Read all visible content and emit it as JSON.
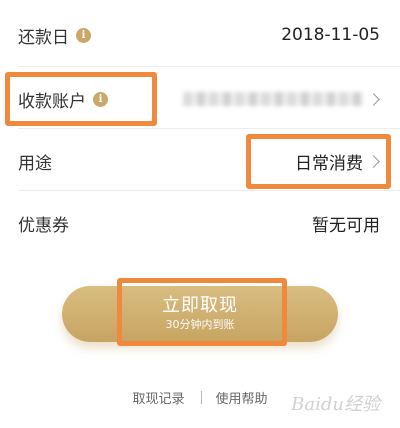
{
  "rows": {
    "due_date": {
      "label": "还款日",
      "value": "2018-11-05"
    },
    "account": {
      "label": "收款账户"
    },
    "purpose": {
      "label": "用途",
      "value": "日常消费"
    },
    "coupon": {
      "label": "优惠券",
      "value": "暂无可用"
    }
  },
  "info_icon_glyph": "i",
  "cta": {
    "title": "立即取现",
    "subtitle": "30分钟内到账"
  },
  "footer": {
    "records": "取现记录",
    "help": "使用帮助"
  },
  "watermark": "Baidu经验",
  "colors": {
    "accent_gold": "#c9a86a",
    "highlight_orange": "#f0883e"
  }
}
